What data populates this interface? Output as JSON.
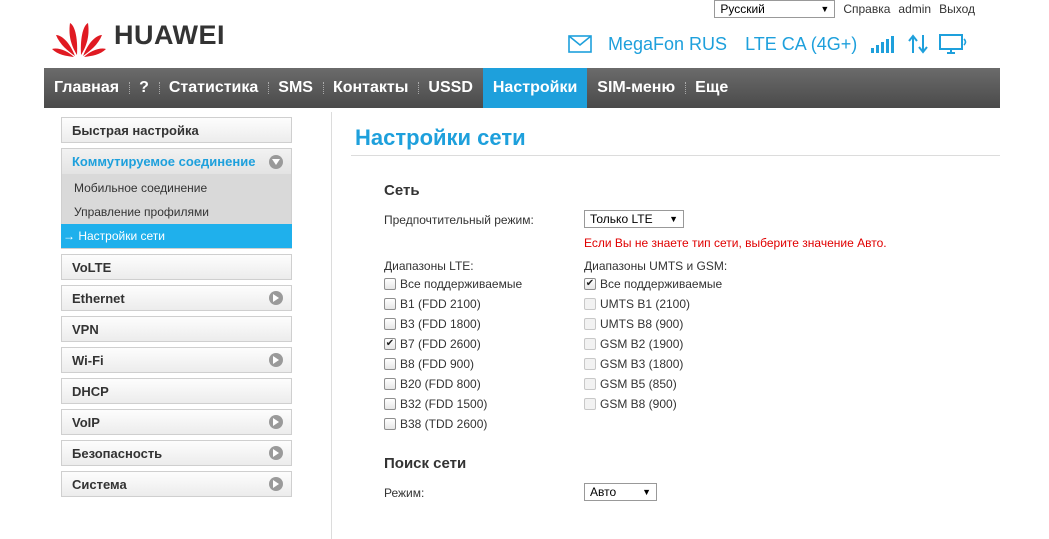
{
  "brand": {
    "name": "HUAWEI"
  },
  "topbar": {
    "language": "Русский",
    "help": "Справка",
    "user": "admin",
    "logout": "Выход"
  },
  "status": {
    "operator": "MegaFon RUS",
    "network_type": "LTE CA (4G+)"
  },
  "nav": {
    "items": [
      "Главная",
      "?",
      "Статистика",
      "SMS",
      "Контакты",
      "USSD",
      "Настройки",
      "SIM-меню",
      "Еще"
    ],
    "active_index": 6
  },
  "sidebar": {
    "items": [
      {
        "label": "Быстрая настройка"
      },
      {
        "label": "Коммутируемое соединение"
      },
      {
        "label": "VoLTE"
      },
      {
        "label": "Ethernet"
      },
      {
        "label": "VPN"
      },
      {
        "label": "Wi-Fi"
      },
      {
        "label": "DHCP"
      },
      {
        "label": "VoIP"
      },
      {
        "label": "Безопасность"
      },
      {
        "label": "Система"
      }
    ],
    "submenu": [
      "Мобильное соединение",
      "Управление профилями",
      "→ Настройки сети"
    ]
  },
  "main": {
    "title": "Настройки сети",
    "network": {
      "title": "Сеть",
      "preferred_mode_label": "Предпочтительный режим:",
      "preferred_mode_value": "Только LTE",
      "warning": "Если Вы не знаете тип сети, выберите значение Авто.",
      "lte_label": "Диапазоны LTE:",
      "lte_bands": [
        {
          "label": "Все поддерживаемые",
          "checked": false
        },
        {
          "label": "B1 (FDD 2100)",
          "checked": false
        },
        {
          "label": "B3 (FDD 1800)",
          "checked": false
        },
        {
          "label": "B7 (FDD 2600)",
          "checked": true
        },
        {
          "label": "B8 (FDD 900)",
          "checked": false
        },
        {
          "label": "B20 (FDD 800)",
          "checked": false
        },
        {
          "label": "B32 (FDD 1500)",
          "checked": false
        },
        {
          "label": "B38 (TDD 2600)",
          "checked": false
        }
      ],
      "umts_label": "Диапазоны UMTS и GSM:",
      "umts_bands": [
        {
          "label": "Все поддерживаемые",
          "checked": true
        },
        {
          "label": "UMTS B1 (2100)",
          "checked": false
        },
        {
          "label": "UMTS B8 (900)",
          "checked": false
        },
        {
          "label": "GSM B2 (1900)",
          "checked": false
        },
        {
          "label": "GSM B3 (1800)",
          "checked": false
        },
        {
          "label": "GSM B5 (850)",
          "checked": false
        },
        {
          "label": "GSM B8 (900)",
          "checked": false
        }
      ]
    },
    "search": {
      "title": "Поиск сети",
      "mode_label": "Режим:",
      "mode_value": "Авто"
    }
  },
  "colors": {
    "accent": "#1ea0dc",
    "warning": "#e00000",
    "nav_bg": "#555555"
  }
}
